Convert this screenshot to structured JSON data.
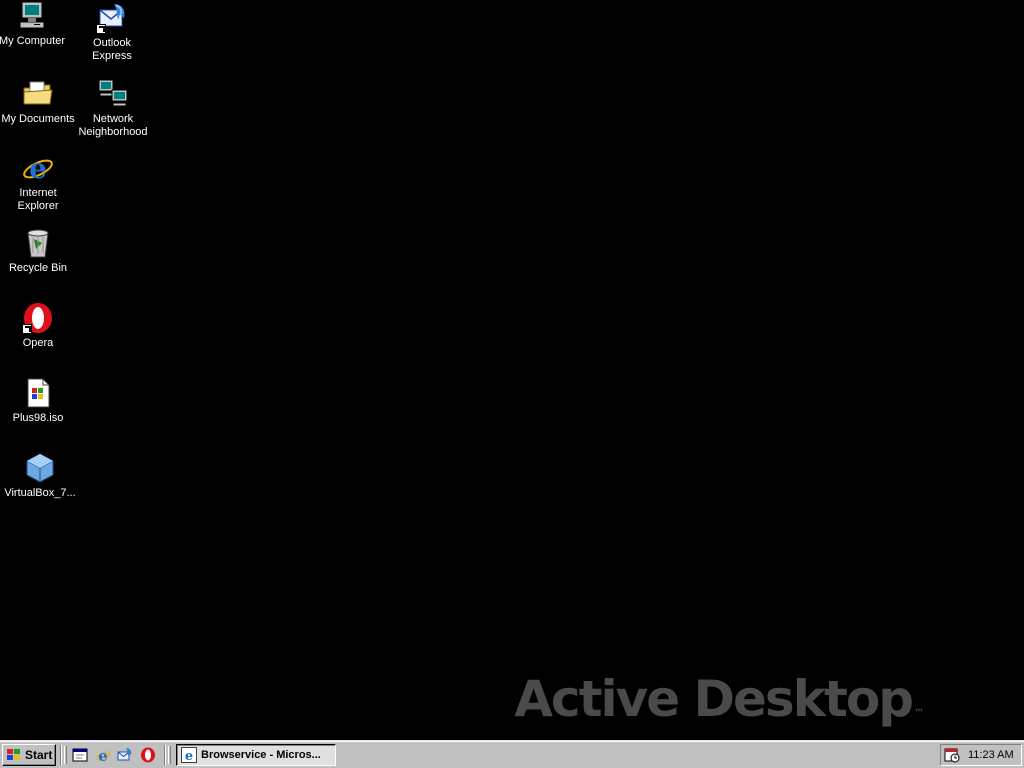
{
  "desktop": {
    "icons": [
      {
        "label": "My Computer",
        "icon": "computer-icon"
      },
      {
        "label": "Outlook\nExpress",
        "icon": "outlook-express-icon"
      },
      {
        "label": "My Documents",
        "icon": "folder-icon"
      },
      {
        "label": "Network\nNeighborhood",
        "icon": "network-icon"
      },
      {
        "label": "Internet\nExplorer",
        "icon": "internet-explorer-icon"
      },
      {
        "label": "Recycle Bin",
        "icon": "recycle-bin-icon"
      },
      {
        "label": "Opera",
        "icon": "opera-icon"
      },
      {
        "label": "Plus98.iso",
        "icon": "iso-file-icon"
      },
      {
        "label": "VirtualBox_7...",
        "icon": "virtualbox-icon"
      }
    ],
    "watermark": {
      "text": "Active Desktop",
      "tm": "™"
    }
  },
  "taskbar": {
    "start_label": "Start",
    "quick_launch": [
      {
        "icon": "show-desktop-icon"
      },
      {
        "icon": "internet-explorer-icon"
      },
      {
        "icon": "outlook-express-icon"
      },
      {
        "icon": "opera-icon"
      }
    ],
    "task_button_label": "Browservice - Micros...",
    "clock": "11:23 AM"
  },
  "colors": {
    "desktop_bg": "#000000",
    "taskbar_bg": "#c0c0c0",
    "watermark": "#4a4a4a",
    "label_text": "#ffffff"
  }
}
